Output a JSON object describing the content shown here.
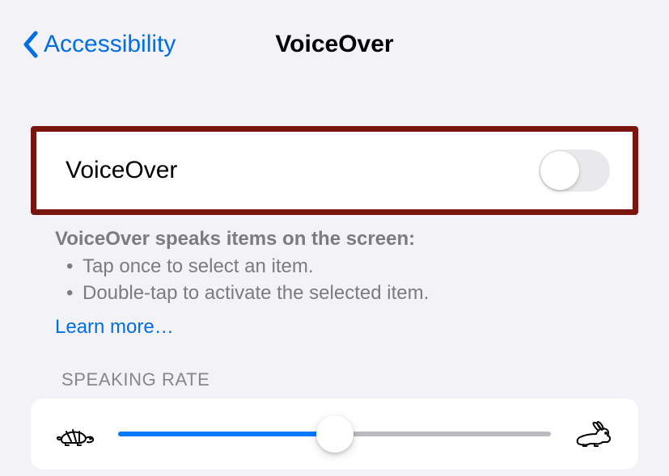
{
  "nav": {
    "back_label": "Accessibility",
    "title": "VoiceOver"
  },
  "voiceover_toggle": {
    "label": "VoiceOver",
    "state": "off"
  },
  "description": {
    "heading": "VoiceOver speaks items on the screen:",
    "bullets": [
      "Tap once to select an item.",
      "Double-tap to activate the selected item."
    ],
    "learn_more": "Learn more…"
  },
  "speaking_rate": {
    "header": "SPEAKING RATE",
    "value_percent": 50,
    "min_icon": "tortoise-icon",
    "max_icon": "hare-icon"
  }
}
